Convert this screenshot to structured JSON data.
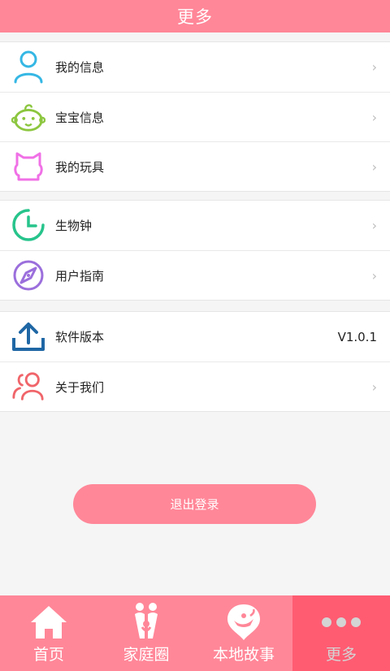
{
  "header": {
    "title": "更多"
  },
  "groups": [
    {
      "items": [
        {
          "label": "我的信息",
          "icon": "user-icon"
        },
        {
          "label": "宝宝信息",
          "icon": "baby-face-icon"
        },
        {
          "label": "我的玩具",
          "icon": "toy-bear-icon"
        }
      ]
    },
    {
      "items": [
        {
          "label": "生物钟",
          "icon": "clock-icon"
        },
        {
          "label": "用户指南",
          "icon": "compass-icon"
        }
      ]
    },
    {
      "items": [
        {
          "label": "软件版本",
          "icon": "upload-icon",
          "value": "V1.0.1"
        },
        {
          "label": "关于我们",
          "icon": "people-icon"
        }
      ]
    }
  ],
  "chevron": "›",
  "logout": {
    "label": "退出登录"
  },
  "tabs": [
    {
      "label": "首页",
      "icon": "home-icon"
    },
    {
      "label": "家庭圈",
      "icon": "family-icon"
    },
    {
      "label": "本地故事",
      "icon": "story-lamp-icon"
    },
    {
      "label": "更多",
      "icon": "more-dots-icon",
      "active": true
    }
  ],
  "colors": {
    "accent": "#ff8798",
    "active_tab": "#ff5c72"
  }
}
